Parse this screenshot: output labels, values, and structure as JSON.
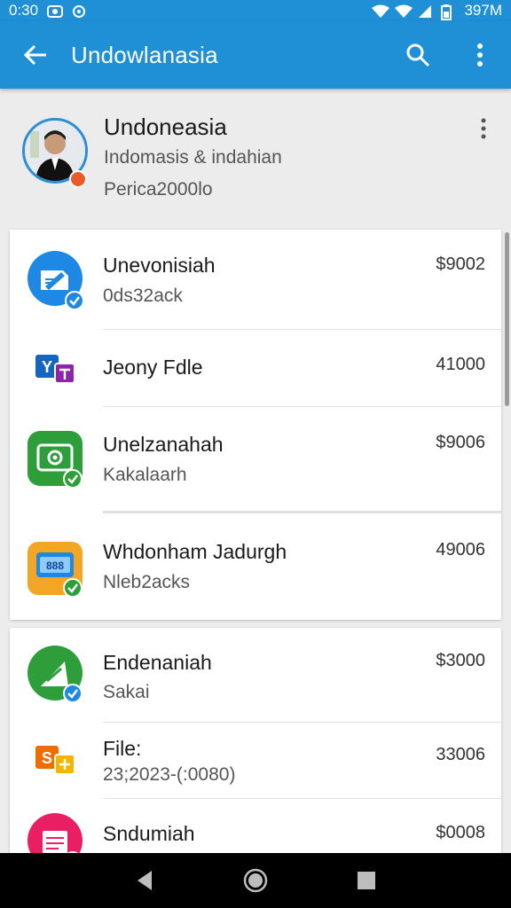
{
  "status_bar": {
    "time": "0:30",
    "battery_text": "397M",
    "icons": [
      "screenshot-icon",
      "notification-icon",
      "wifi-icon",
      "signal-icon",
      "battery-icon"
    ]
  },
  "app_bar": {
    "title": "Undowlanasia",
    "icons": [
      "back-arrow-icon",
      "search-icon",
      "more-vert-icon"
    ]
  },
  "profile": {
    "name": "Undoneasia",
    "line1": "Indomasis & indahian",
    "line2": "Perica2000lo"
  },
  "group1": [
    {
      "title": "Unevonisiah",
      "subtitle": "0ds32ack",
      "amount": "$9002",
      "icon": "edit-doc-icon",
      "color": "#1e88e5"
    },
    {
      "title": "Jeony Fdle",
      "subtitle": "",
      "amount": "41000",
      "icon": "yahoo-app-icon",
      "color": "#1565c0"
    },
    {
      "title": "Unelzanahah",
      "subtitle": "Kakalaarh",
      "amount": "$9006",
      "icon": "camera-app-icon",
      "color": "#2e9e3a"
    },
    {
      "title": "Whdonham Jadurgh",
      "subtitle": "Nleb2acks",
      "amount": "49006",
      "icon": "calculator-app-icon",
      "color": "#f2a623"
    }
  ],
  "group2": [
    {
      "title": "Endenaniah",
      "subtitle": "Sakai",
      "amount": "$3000",
      "icon": "map-app-icon",
      "color": "#2e9e3a"
    },
    {
      "title": "File:",
      "subtitle": "23;2023-(:0080)",
      "amount": "33006",
      "icon": "slides-app-icon",
      "color": "#ef6c00"
    },
    {
      "title": "Sndumiah",
      "subtitle": "",
      "amount": "$0008",
      "icon": "notes-app-icon",
      "color": "#e91e63"
    }
  ],
  "colors": {
    "app_bar": "#1f8fd6",
    "background": "#ececec",
    "check_badge": "#1e88e5",
    "green_badge": "#2e9e3a"
  }
}
